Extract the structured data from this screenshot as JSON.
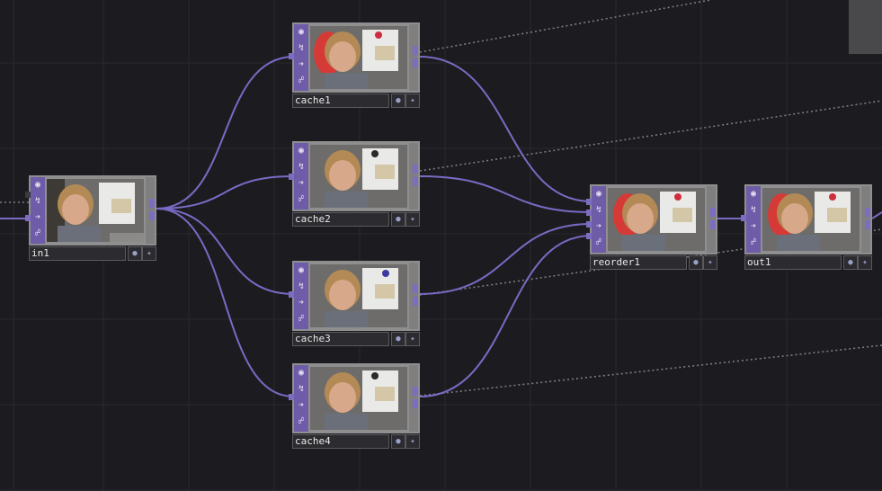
{
  "network": {
    "background_color": "#1c1c20",
    "wire_color": "#7a6ac4",
    "node_color": "#6e5ca8",
    "nodes": [
      {
        "id": "in1",
        "label": "in1"
      },
      {
        "id": "cache1",
        "label": "cache1"
      },
      {
        "id": "cache2",
        "label": "cache2"
      },
      {
        "id": "cache3",
        "label": "cache3"
      },
      {
        "id": "cache4",
        "label": "cache4"
      },
      {
        "id": "reorder1",
        "label": "reorder1"
      },
      {
        "id": "out1",
        "label": "out1"
      }
    ],
    "node_side_icons": [
      "viewer-icon",
      "bypass-icon",
      "arrow-right-icon",
      "cook-icon"
    ],
    "node_flag_icons": [
      "display-flag-icon",
      "render-flag-icon"
    ]
  }
}
